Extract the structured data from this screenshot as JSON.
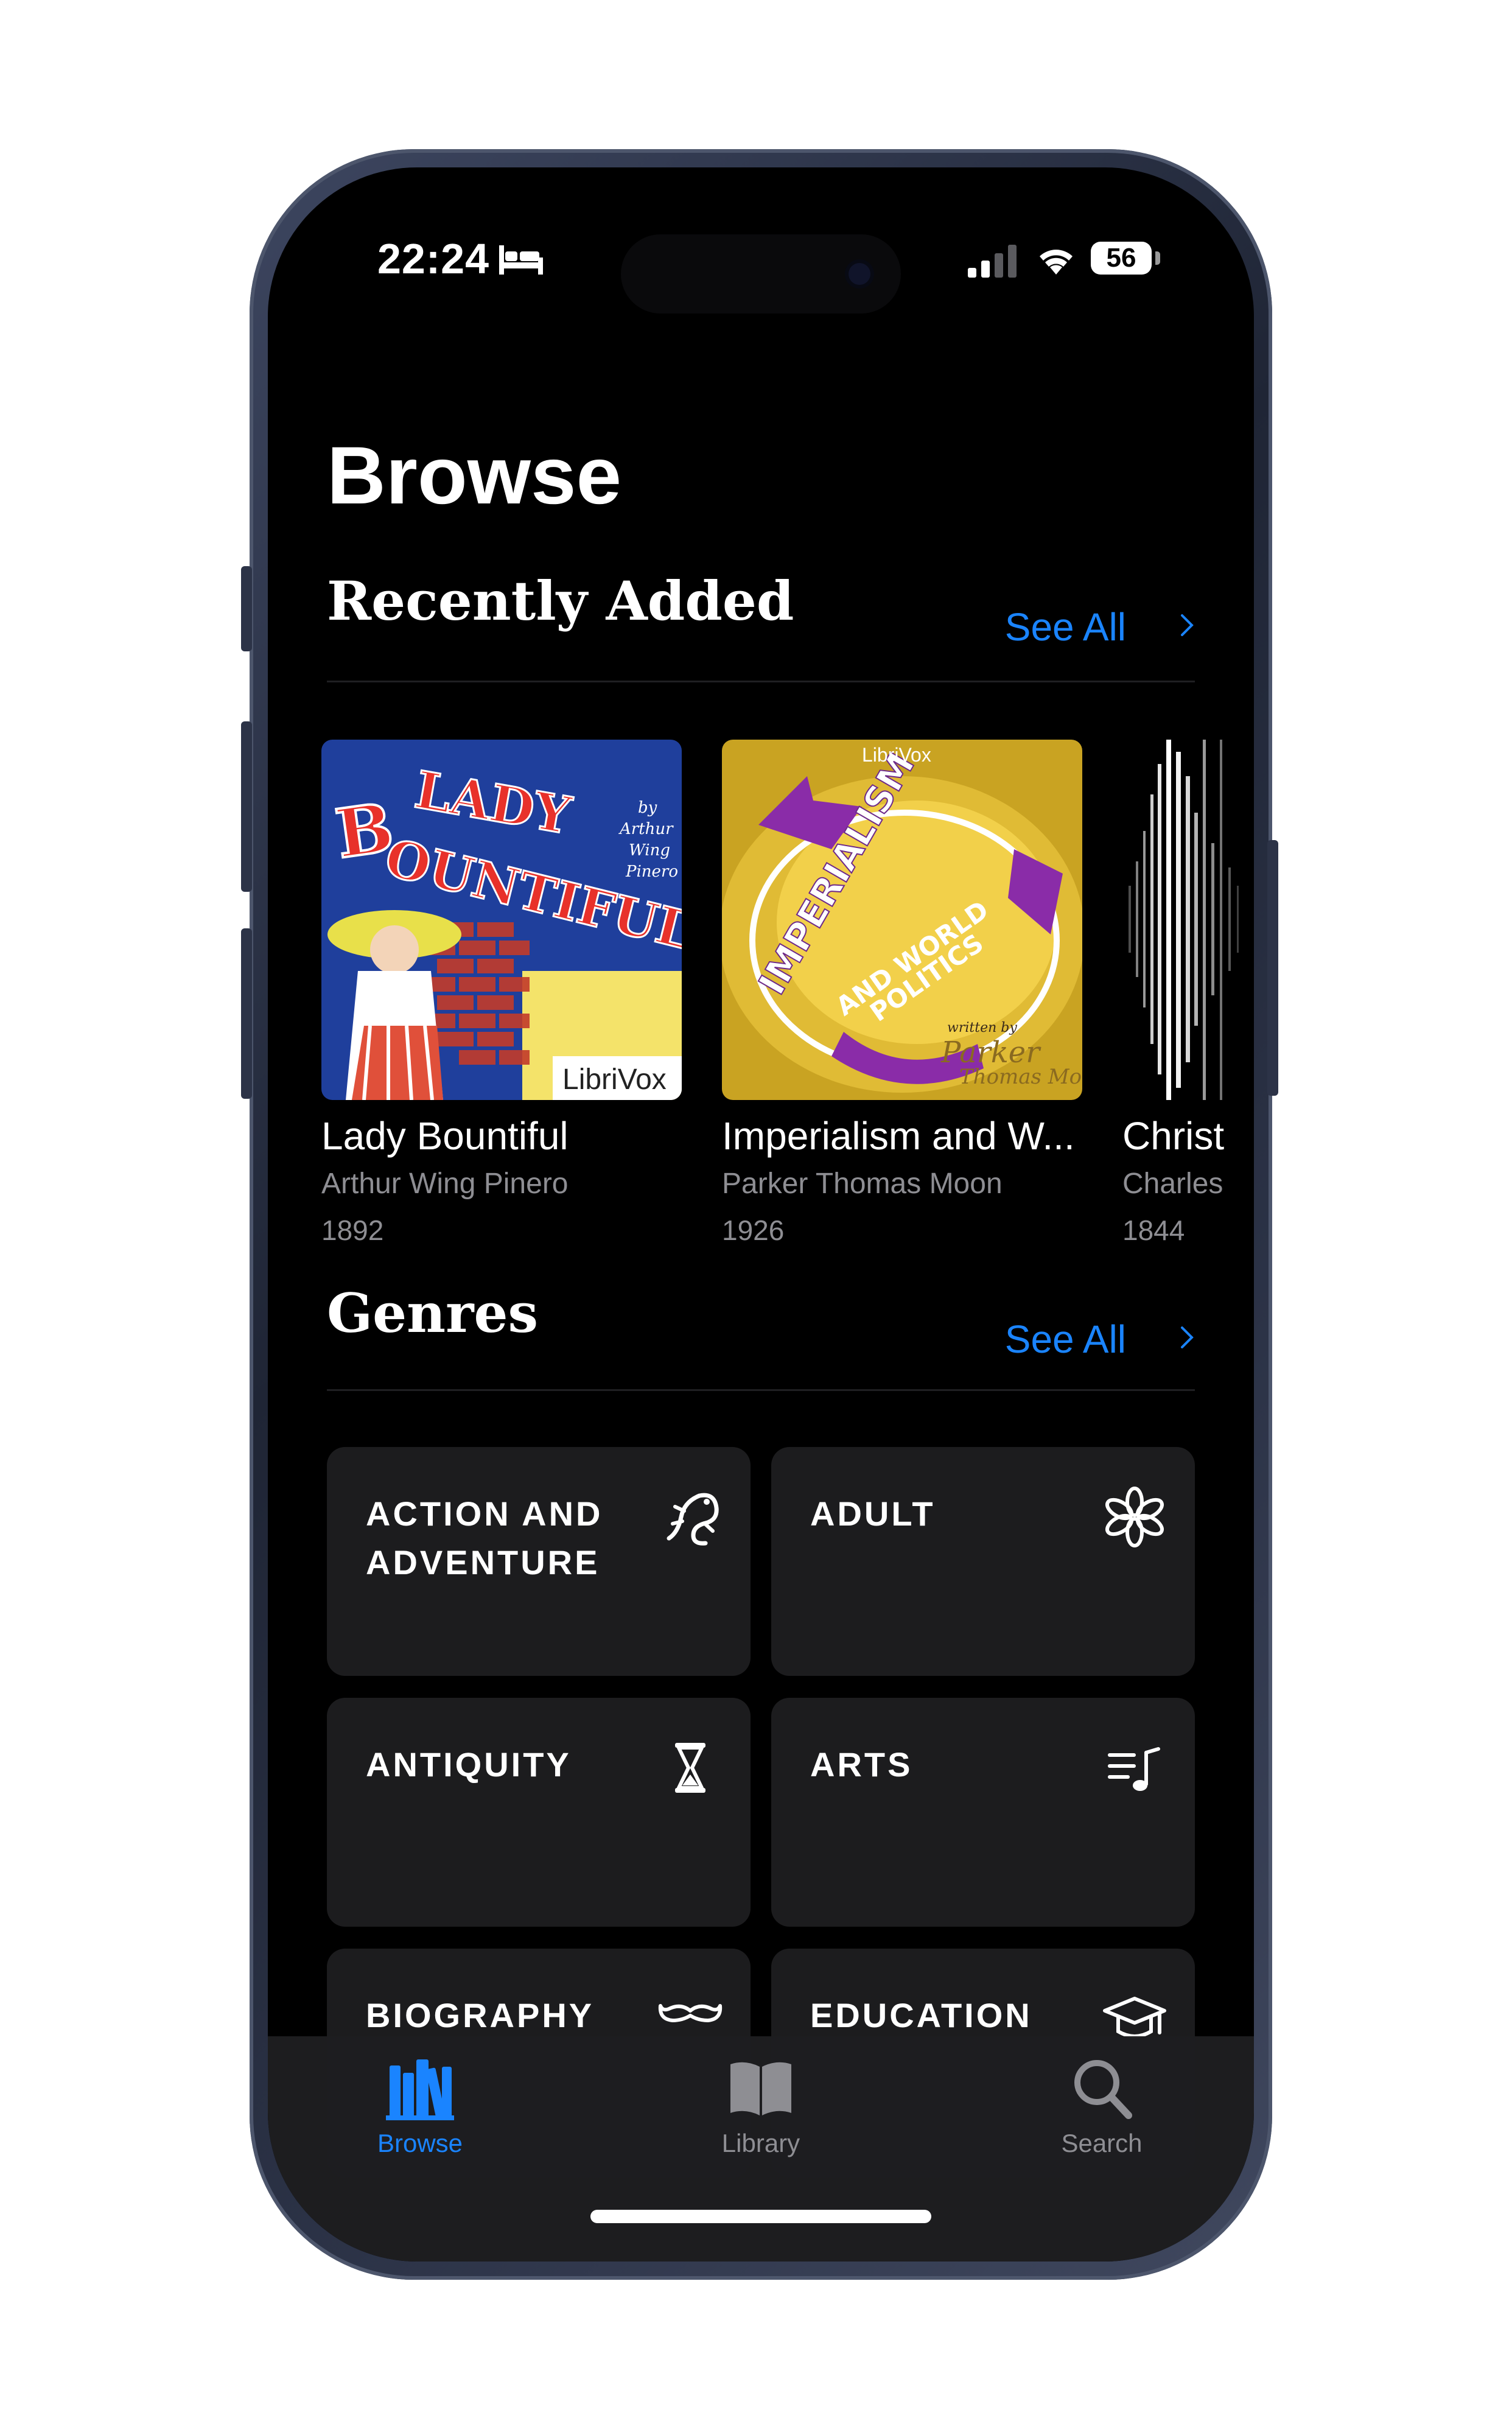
{
  "status_bar": {
    "time": "22:24",
    "battery": "56"
  },
  "page": {
    "title": "Browse"
  },
  "recently_added": {
    "title": "Recently Added",
    "see_all": "See All",
    "books": [
      {
        "title": "Lady Bountiful",
        "author": "Arthur Wing Pinero",
        "year": "1892",
        "cover": {
          "title_text": "LADY BOUNTIFUL",
          "byline": "by Arthur Wing Pinero",
          "publisher": "LibriVox"
        }
      },
      {
        "title": "Imperialism and W...",
        "author": "Parker Thomas Moon",
        "year": "1926",
        "cover": {
          "title_text": "IMPERIALISM AND WORLD POLITICS",
          "byline": "written by Parker Thomas Moon",
          "publisher": "LibriVox"
        }
      },
      {
        "title": "Christ",
        "author": "Charles",
        "year": "1844"
      }
    ]
  },
  "genres": {
    "title": "Genres",
    "see_all": "See All",
    "items": [
      {
        "label": "ACTION AND ADVENTURE",
        "icon": "lizard-icon"
      },
      {
        "label": "ADULT",
        "icon": "asterisk-flower-icon"
      },
      {
        "label": "ANTIQUITY",
        "icon": "hourglass-icon"
      },
      {
        "label": "ARTS",
        "icon": "music-note-list-icon"
      },
      {
        "label": "BIOGRAPHY",
        "icon": "mustache-icon"
      },
      {
        "label": "EDUCATION",
        "icon": "graduation-cap-icon"
      }
    ]
  },
  "tabbar": {
    "tabs": [
      {
        "label": "Browse",
        "icon": "books-icon",
        "active": true
      },
      {
        "label": "Library",
        "icon": "open-book-icon",
        "active": false
      },
      {
        "label": "Search",
        "icon": "magnifier-icon",
        "active": false
      }
    ]
  },
  "colors": {
    "accent": "#1a84ff",
    "background": "#000000",
    "tile": "#1c1c1e",
    "secondary_text": "#8e8e93"
  }
}
